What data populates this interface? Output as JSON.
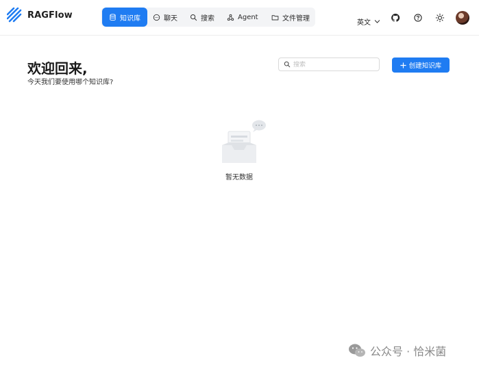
{
  "brand": {
    "name": "RAGFlow"
  },
  "nav": {
    "items": [
      {
        "label": "知识库",
        "icon": "database-icon",
        "active": true
      },
      {
        "label": "聊天",
        "icon": "chat-icon"
      },
      {
        "label": "搜索",
        "icon": "search-icon"
      },
      {
        "label": "Agent",
        "icon": "agent-icon"
      },
      {
        "label": "文件管理",
        "icon": "folder-icon"
      }
    ]
  },
  "toolbar": {
    "language": "英文",
    "icons": [
      "github-icon",
      "help-icon",
      "theme-sun-icon",
      "user-avatar"
    ]
  },
  "main": {
    "welcome_title": "欢迎回来,",
    "welcome_subtitle": "今天我们要使用哪个知识库?",
    "search_placeholder": "搜索",
    "create_button": "创建知识库",
    "empty_text": "暂无数据"
  },
  "watermark": {
    "text": "公众号 · 恰米菌"
  },
  "colors": {
    "accent": "#1f7cf2",
    "nav_bg": "#f3f4f6",
    "border": "#ececec"
  }
}
